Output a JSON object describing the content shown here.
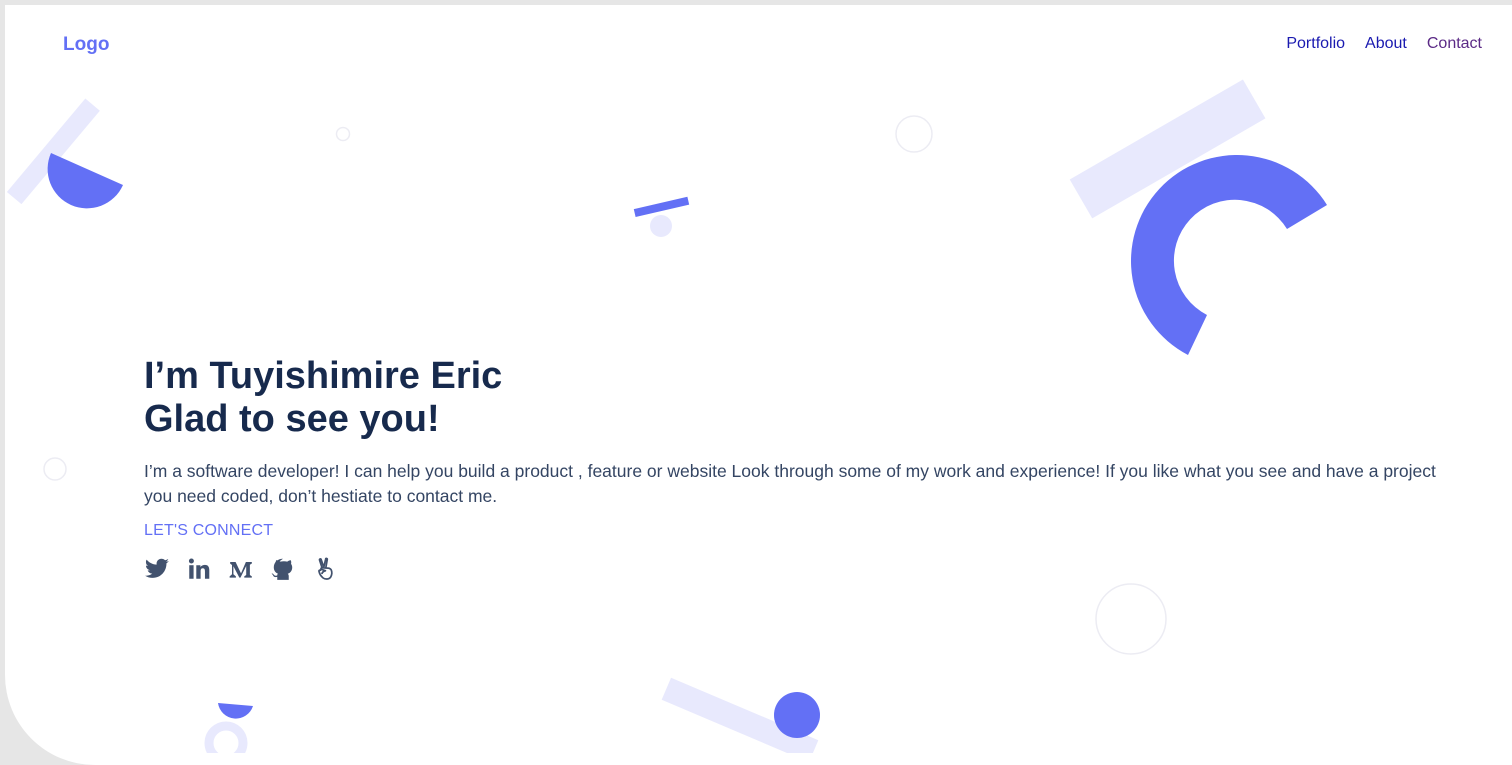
{
  "header": {
    "logo": "Logo",
    "nav": [
      {
        "label": "Portfolio"
      },
      {
        "label": "About"
      },
      {
        "label": "Contact"
      }
    ]
  },
  "hero": {
    "title_line1": "I’m Tuyishimire Eric",
    "title_line2": "Glad to see you!",
    "description": "I’m a software developer! I can help you build a product , feature or website Look through some of my work and experience! If you like what you see and have a project you need coded, don’t hestiate to contact me.",
    "connect_label": "LET'S CONNECT",
    "social_icons": [
      "twitter-icon",
      "linkedin-icon",
      "medium-icon",
      "github-icon",
      "angellist-icon"
    ]
  },
  "colors": {
    "accent": "#6370f5",
    "accent_light": "#e8e9fd",
    "heading": "#172a4d",
    "body_text": "#344563",
    "nav_link": "#1a1ab0",
    "nav_visited": "#5b2a86",
    "frame": "#e6e6e6"
  }
}
